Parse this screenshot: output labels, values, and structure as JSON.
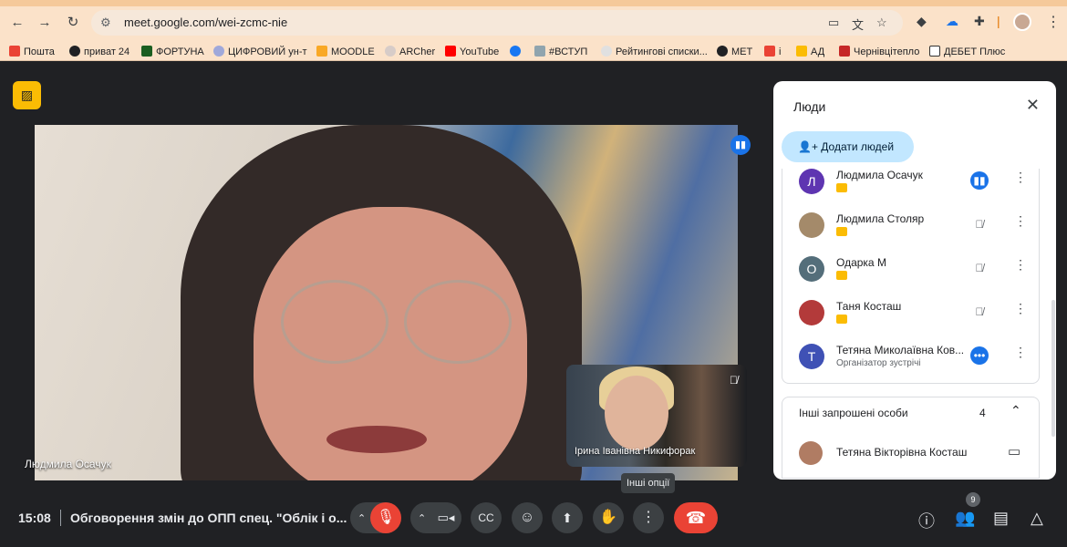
{
  "browser": {
    "url": "meet.google.com/wei-zcmc-nie",
    "bookmarks": [
      "Пошта",
      "приват 24",
      "ФОРТУНА",
      "ЦИФРОВИЙ ун-т",
      "MOODLE",
      "ARCher",
      "YouTube",
      "#ВСТУП",
      "Рейтингові списки...",
      "МЕТ",
      "і",
      "АД",
      "Чернівцітепло",
      "ДЕБЕТ Плюс"
    ]
  },
  "meeting": {
    "main_speaker": "Людмила Осачук",
    "self_view_name": "Ірина Іванівна Никифорак",
    "tooltip": "Інші опції",
    "time": "15:08",
    "title": "Обговорення змін до ОПП спец. \"Облік і о..."
  },
  "toolbar": {
    "participant_count": "9"
  },
  "people_panel": {
    "title": "Люди",
    "add_label": "Додати людей",
    "participants": [
      {
        "initial": "Л",
        "name": "Людмила Осачук",
        "subtitle": "",
        "status": "speaking",
        "avatar_color": "#5e35b1"
      },
      {
        "initial": "",
        "name": "Людмила Столяр",
        "subtitle": "",
        "status": "muted",
        "avatar_color": "#a48a6a"
      },
      {
        "initial": "О",
        "name": "Одарка М",
        "subtitle": "",
        "status": "muted",
        "avatar_color": "#546e7a"
      },
      {
        "initial": "",
        "name": "Таня Косташ",
        "subtitle": "",
        "status": "muted",
        "avatar_color": "#b33a3a"
      },
      {
        "initial": "Т",
        "name": "Тетяна Миколаївна Ков...",
        "subtitle": "Організатор зустрічі",
        "status": "more",
        "avatar_color": "#3f51b5"
      }
    ],
    "invited_label": "Інші запрошені особи",
    "invited_count": "4",
    "invited": [
      {
        "name": "Тетяна Вікторівна Косташ"
      }
    ]
  }
}
